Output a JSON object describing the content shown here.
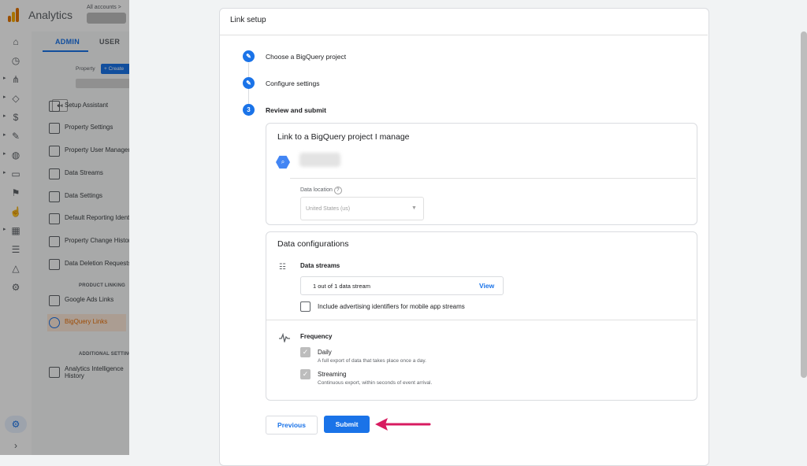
{
  "app": {
    "title": "Analytics",
    "breadcrumb": "All accounts > "
  },
  "admin": {
    "tabs": [
      "ADMIN",
      "USER"
    ],
    "property_label": "Property",
    "create_label": "Create",
    "menu": [
      {
        "label": "Setup Assistant"
      },
      {
        "label": "Property Settings"
      },
      {
        "label": "Property User Management"
      },
      {
        "label": "Data Streams"
      },
      {
        "label": "Data Settings"
      },
      {
        "label": "Default Reporting Identity"
      },
      {
        "label": "Property Change History"
      },
      {
        "label": "Data Deletion Requests"
      }
    ],
    "product_linking_header": "PRODUCT LINKING",
    "product_links": [
      {
        "label": "Google Ads Links"
      },
      {
        "label": "BigQuery Links"
      }
    ],
    "additional_header": "ADDITIONAL SETTINGS",
    "additional_item": [
      "Analytics Intelligence",
      "History"
    ]
  },
  "drawer": {
    "title": "Link setup",
    "steps": [
      {
        "number": "",
        "label": "Choose a BigQuery project",
        "status": "done"
      },
      {
        "number": "",
        "label": "Configure settings",
        "status": "done"
      },
      {
        "number": "3",
        "label": "Review and submit",
        "status": "current"
      }
    ],
    "link_panel": {
      "heading": "Link to a BigQuery project I manage",
      "data_location_label": "Data location",
      "data_location_value": "United States (us)"
    },
    "config_panel": {
      "heading": "Data configurations",
      "streams_label": "Data streams",
      "streams_value": "1 out of 1 data stream",
      "view_label": "View",
      "include_ad_ids_label": "Include advertising identifiers for mobile app streams",
      "frequency_label": "Frequency",
      "daily_label": "Daily",
      "daily_desc": "A full export of data that takes place once a day.",
      "streaming_label": "Streaming",
      "streaming_desc": "Continuous export, within seconds of event arrival."
    },
    "buttons": {
      "previous": "Previous",
      "submit": "Submit"
    }
  },
  "colors": {
    "accent": "#1a73e8",
    "arrow": "#d81b60",
    "active_item": "#e8710a"
  }
}
